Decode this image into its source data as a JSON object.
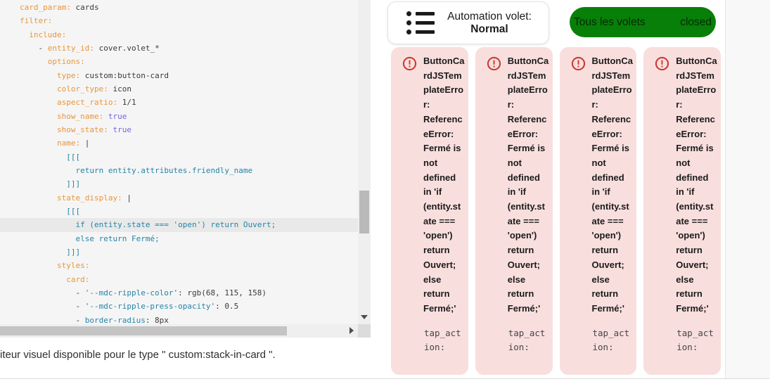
{
  "colors": {
    "syntax_key": "#e8963c",
    "syntax_value": "#3a3a3a",
    "syntax_atom_true": "#7665e0",
    "syntax_js_string": "#2484a8",
    "editor_background": "#f5f5f5",
    "editor_active_line": "#e9e9e9",
    "pill_green": "#087f08",
    "error_red": "#ca3a31",
    "error_card_background": "#f9dede"
  },
  "icons": {
    "menu": "format-list-bulleted",
    "error": "alert-circle-outline",
    "scroll_down": "triangle-down",
    "scroll_right": "triangle-right"
  },
  "editor": {
    "highlight_line": 16,
    "lines": [
      [
        [
          "k",
          "card_param:"
        ],
        [
          "v",
          " cards"
        ]
      ],
      [
        [
          "k",
          "filter:"
        ]
      ],
      [
        [
          "v",
          "  "
        ],
        [
          "k",
          "include:"
        ]
      ],
      [
        [
          "v",
          "    - "
        ],
        [
          "k",
          "entity_id:"
        ],
        [
          "v",
          " cover.volet_*"
        ]
      ],
      [
        [
          "v",
          "      "
        ],
        [
          "k",
          "options:"
        ]
      ],
      [
        [
          "v",
          "        "
        ],
        [
          "k",
          "type:"
        ],
        [
          "v",
          " custom:button-card"
        ]
      ],
      [
        [
          "v",
          "        "
        ],
        [
          "k",
          "color_type:"
        ],
        [
          "v",
          " icon"
        ]
      ],
      [
        [
          "v",
          "        "
        ],
        [
          "k",
          "aspect_ratio:"
        ],
        [
          "v",
          " 1/1"
        ]
      ],
      [
        [
          "v",
          "        "
        ],
        [
          "k",
          "show_name:"
        ],
        [
          "a",
          " true"
        ]
      ],
      [
        [
          "v",
          "        "
        ],
        [
          "k",
          "show_state:"
        ],
        [
          "a",
          " true"
        ]
      ],
      [
        [
          "v",
          "        "
        ],
        [
          "k",
          "name:"
        ],
        [
          "v",
          " |"
        ]
      ],
      [
        [
          "v",
          "          "
        ],
        [
          "j",
          "[[["
        ]
      ],
      [
        [
          "v",
          "            "
        ],
        [
          "j",
          "return entity.attributes.friendly_name"
        ]
      ],
      [
        [
          "v",
          "          "
        ],
        [
          "j",
          "]]]"
        ]
      ],
      [
        [
          "v",
          "        "
        ],
        [
          "k",
          "state_display:"
        ],
        [
          "v",
          " |"
        ]
      ],
      [
        [
          "v",
          "          "
        ],
        [
          "j",
          "[[["
        ]
      ],
      [
        [
          "v",
          "            "
        ],
        [
          "j",
          "if (entity.state === 'open') return Ouvert;"
        ]
      ],
      [
        [
          "v",
          "            "
        ],
        [
          "j",
          "else return Fermé;"
        ]
      ],
      [
        [
          "v",
          "          "
        ],
        [
          "j",
          "]]]"
        ]
      ],
      [
        [
          "v",
          "        "
        ],
        [
          "k",
          "styles:"
        ]
      ],
      [
        [
          "v",
          "          "
        ],
        [
          "k",
          "card:"
        ]
      ],
      [
        [
          "v",
          "            - "
        ],
        [
          "j",
          "'--mdc-ripple-color'"
        ],
        [
          "v",
          ": rgb(68, 115, 158)"
        ]
      ],
      [
        [
          "v",
          "            - "
        ],
        [
          "j",
          "'--mdc-ripple-press-opacity'"
        ],
        [
          "v",
          ": 0.5"
        ]
      ],
      [
        [
          "v",
          "            - "
        ],
        [
          "j",
          "border-radius"
        ],
        [
          "v",
          ": 8px"
        ]
      ]
    ]
  },
  "footer": {
    "helper_text": "iteur visuel disponible pour le type \" custom:stack-in-card \"."
  },
  "preview": {
    "automation_card": {
      "label": "Automation volet:",
      "value": "Normal"
    },
    "pill": {
      "label": "Tous les volets",
      "state": "closed"
    },
    "error_cards": [
      {
        "message": "ButtonCardJSTemplateError: ReferenceError: Fermé is not defined in 'if (entity.state === 'open') return Ouvert; else return Fermé;'",
        "code": "tap_action:"
      },
      {
        "message": "ButtonCardJSTemplateError: ReferenceError: Fermé is not defined in 'if (entity.state === 'open') return Ouvert; else return Fermé;'",
        "code": "tap_action:"
      },
      {
        "message": "ButtonCardJSTemplateError: ReferenceError: Fermé is not defined in 'if (entity.state === 'open') return Ouvert; else return Fermé;'",
        "code": "tap_action:"
      },
      {
        "message": "ButtonCardJSTemplateError: ReferenceError: Fermé is not defined in 'if (entity.state === 'open') return Ouvert; else return Fermé;'",
        "code": "tap_action:"
      }
    ]
  }
}
